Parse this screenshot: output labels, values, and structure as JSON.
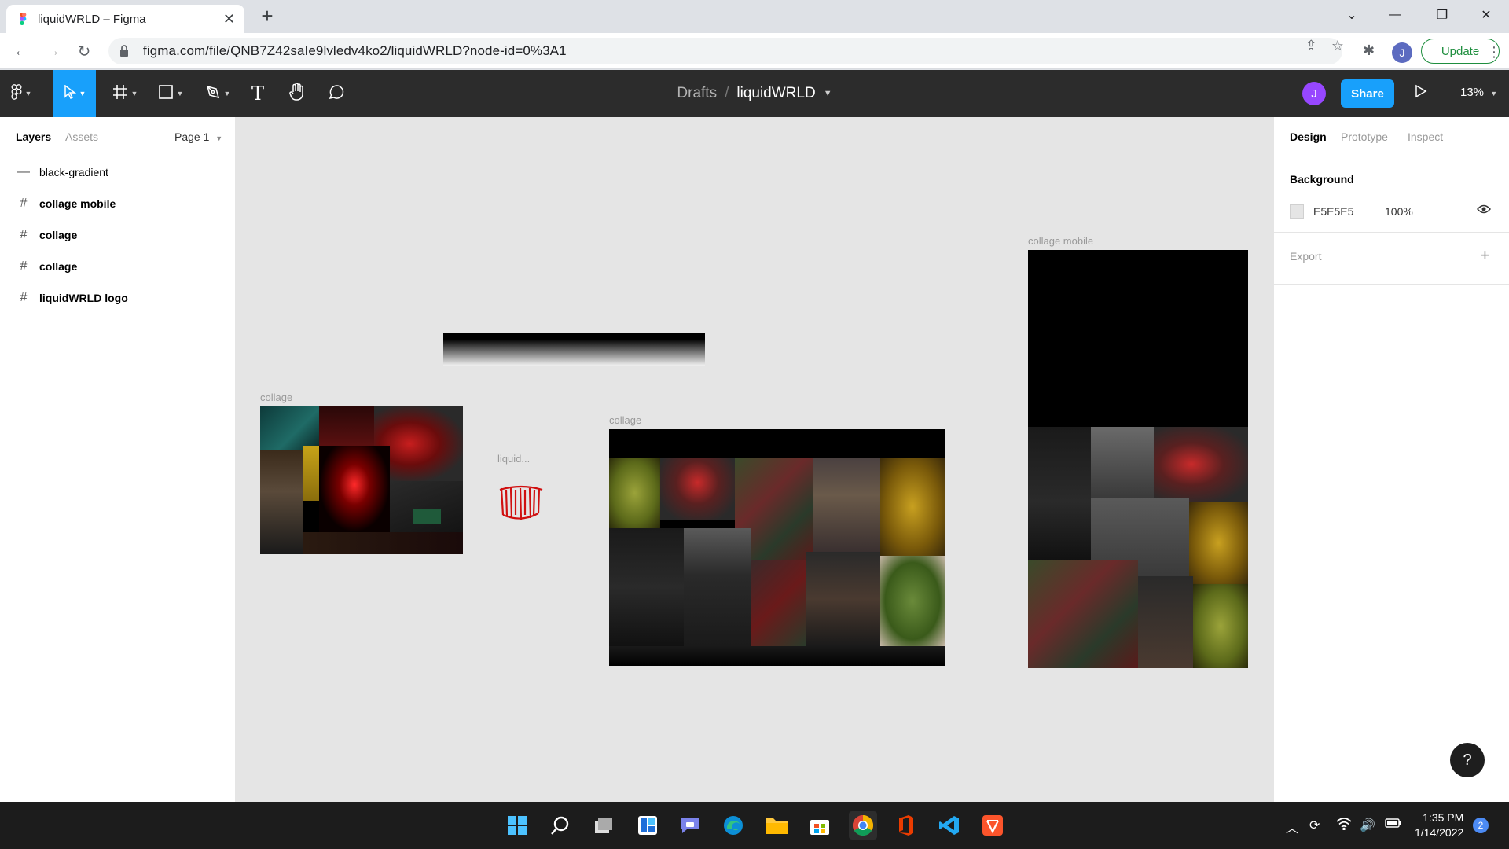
{
  "browser": {
    "tab_title": "liquidWRLD – Figma",
    "url": "figma.com/file/QNB7Z42saIe9lvledv4ko2/liquidWRLD?node-id=0%3A1",
    "profile_initial": "J",
    "update_label": "Update"
  },
  "figma": {
    "breadcrumb_parent": "Drafts",
    "file_name": "liquidWRLD",
    "avatar_initial": "J",
    "share_label": "Share",
    "zoom": "13%"
  },
  "left_panel": {
    "tab_layers": "Layers",
    "tab_assets": "Assets",
    "page": "Page 1",
    "layers": [
      {
        "name": "black-gradient",
        "type": "rect"
      },
      {
        "name": "collage mobile",
        "type": "frame"
      },
      {
        "name": "collage",
        "type": "frame"
      },
      {
        "name": "collage",
        "type": "frame"
      },
      {
        "name": "liquidWRLD logo",
        "type": "frame"
      }
    ]
  },
  "canvas": {
    "labels": {
      "collage_small": "collage",
      "logo": "liquid...",
      "collage_large": "collage",
      "collage_mobile": "collage mobile"
    },
    "background": "#E5E5E5"
  },
  "right_panel": {
    "tabs": [
      "Design",
      "Prototype",
      "Inspect"
    ],
    "background_title": "Background",
    "bg_hex": "E5E5E5",
    "bg_opacity": "100%",
    "export_title": "Export"
  },
  "taskbar": {
    "time": "1:35 PM",
    "date": "1/14/2022",
    "notifications": "2"
  },
  "colors": {
    "figma_blue": "#18a0fb",
    "toolbar_bg": "#2c2c2c",
    "canvas_bg": "#e5e5e5"
  }
}
